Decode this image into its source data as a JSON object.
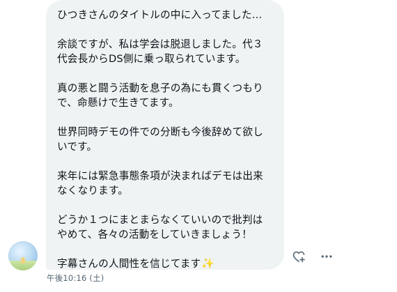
{
  "message": {
    "lines": [
      "ひつきさんのタイトルの中に入ってました…",
      "余談ですが、私は学会は脱退しました。代３\n代会長からDS側に乗っ取られています。",
      "真の悪と闘う活動を息子の為にも貫くつもり\nで、命懸けで生きてます。",
      "世界同時デモの件での分断も今後辞めて欲し\nいです。",
      "来年には緊急事態条項が決まればデモは出来\nなくなります。",
      "どうか１つにまとまらなくていいので批判は\nやめて、各々の活動をしていきましょう！",
      "字幕さんの人間性を信じてます"
    ],
    "timestamp": "午後10:16 (土)"
  },
  "icons": {
    "avatar": "user-avatar",
    "sparkle": "sparkles-icon",
    "react": "heart-plus-icon",
    "more": "more-dots-icon"
  },
  "colors": {
    "bubble": "#eff3f4",
    "text": "#0f1419",
    "muted": "#536471",
    "sparkle": "#f5c542"
  }
}
